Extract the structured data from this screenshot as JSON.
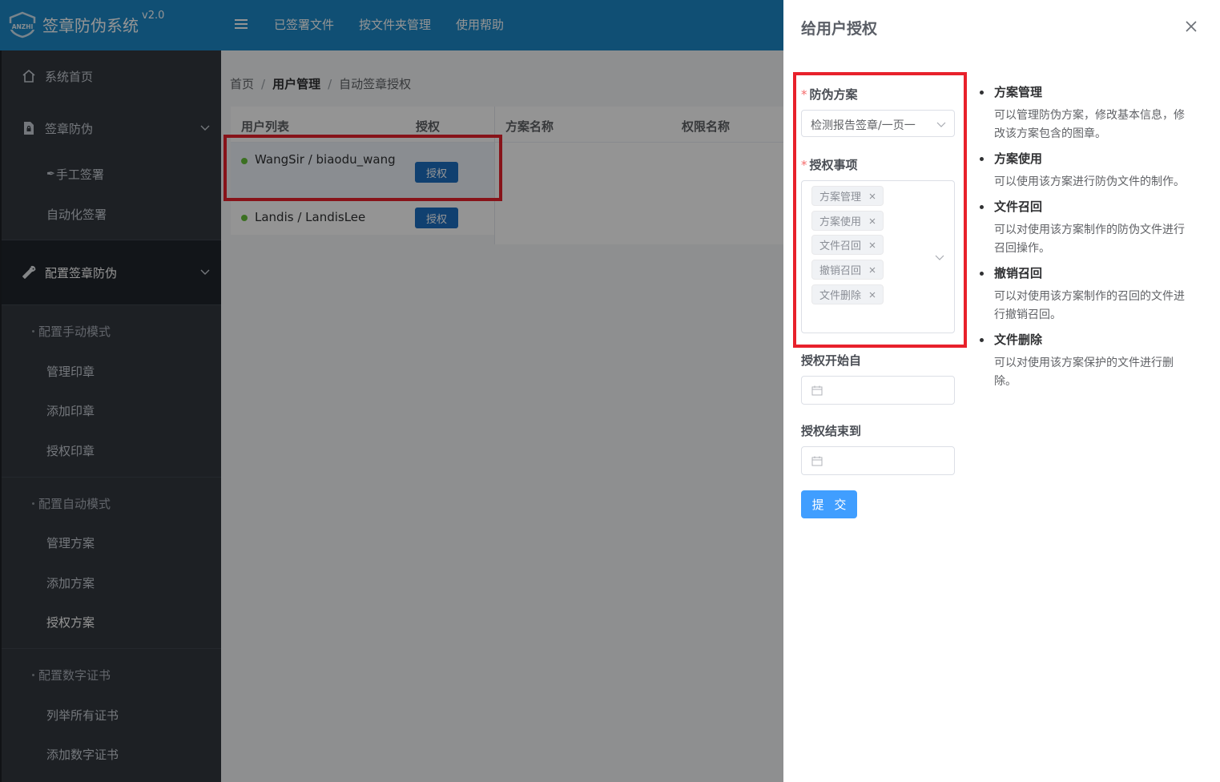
{
  "app": {
    "title": "签章防伪系统",
    "version": "v2.0",
    "logo_text": "ANZHI"
  },
  "top_nav": [
    "已签署文件",
    "按文件夹管理",
    "使用帮助"
  ],
  "sidebar": {
    "home": "系统首页",
    "sign_menu": "签章防伪",
    "manual_sign": "手工签署",
    "auto_sign": "自动化签署",
    "config_menu": "配置签章防伪",
    "group_manual": "配置手动模式",
    "manage_seal": "管理印章",
    "add_seal": "添加印章",
    "auth_seal": "授权印章",
    "group_auto": "配置自动模式",
    "manage_plan": "管理方案",
    "add_plan": "添加方案",
    "auth_plan": "授权方案",
    "group_cert": "配置数字证书",
    "list_cert": "列举所有证书",
    "add_cert": "添加数字证书"
  },
  "breadcrumb": [
    "首页",
    "用户管理",
    "自动签章授权"
  ],
  "user_table": {
    "headers": [
      "用户列表",
      "授权"
    ],
    "rows": [
      {
        "name": "WangSir / biaodu_wang",
        "action": "授权",
        "status": "online"
      },
      {
        "name": "Landis / LandisLee",
        "action": "授权",
        "status": "online"
      }
    ]
  },
  "plan_table": {
    "headers": [
      "方案名称",
      "权限名称"
    ]
  },
  "drawer": {
    "title": "给用户授权",
    "plan_label": "防伪方案",
    "plan_value": "检测报告签章/一页一",
    "items_label": "授权事项",
    "items": [
      "方案管理",
      "方案使用",
      "文件召回",
      "撤销召回",
      "文件删除"
    ],
    "start_label": "授权开始自",
    "end_label": "授权结束到",
    "submit": "提 交",
    "help": [
      {
        "title": "方案管理",
        "desc": "可以管理防伪方案，修改基本信息，修改该方案包含的图章。"
      },
      {
        "title": "方案使用",
        "desc": "可以使用该方案进行防伪文件的制作。"
      },
      {
        "title": "文件召回",
        "desc": "可以对使用该方案制作的防伪文件进行召回操作。"
      },
      {
        "title": "撤销召回",
        "desc": "可以对使用该方案制作的召回的文件进行撤销召回。"
      },
      {
        "title": "文件删除",
        "desc": "可以对使用该方案保护的文件进行删除。"
      }
    ]
  },
  "colors": {
    "header": "#1c88c8",
    "sidebar": "#32383f",
    "primary_button": "#409eff",
    "table_button": "#1c6fc2",
    "highlight": "#e8212b",
    "required": "#f56c6c",
    "status_online": "#67c23a"
  }
}
